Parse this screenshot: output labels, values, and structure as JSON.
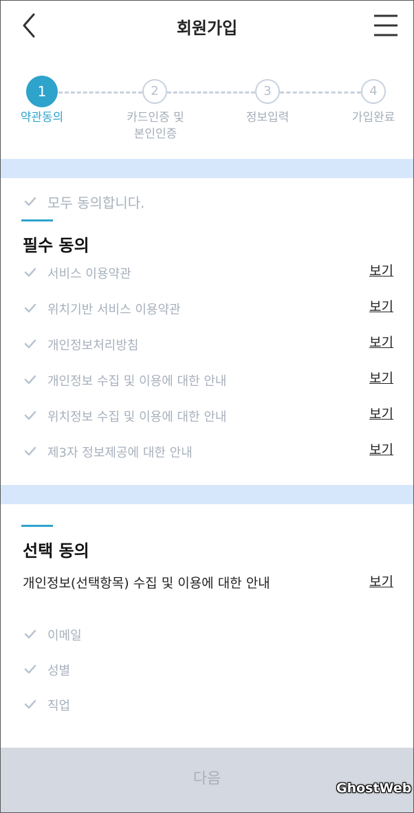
{
  "header": {
    "title": "회원가입",
    "back_icon": "chevron-left-icon",
    "menu_icon": "hamburger-menu-icon"
  },
  "steps": [
    {
      "number": "1",
      "label": "약관동의",
      "active": true
    },
    {
      "number": "2",
      "label": "카드인증 및\n본인인증",
      "active": false
    },
    {
      "number": "3",
      "label": "정보입력",
      "active": false
    },
    {
      "number": "4",
      "label": "가입완료",
      "active": false
    }
  ],
  "colors": {
    "accent": "#2ea3cc",
    "band": "#d6e7fb",
    "check": "#b9c3cf",
    "next_button_bg": "#d4d8e0"
  },
  "agree_all": {
    "label": "모두 동의합니다."
  },
  "required": {
    "title": "필수 동의",
    "items": [
      {
        "label": "서비스 이용약관",
        "link": "보기"
      },
      {
        "label": "위치기반 서비스 이용약관",
        "link": "보기"
      },
      {
        "label": "개인정보처리방침",
        "link": "보기"
      },
      {
        "label": "개인정보 수집 및 이용에 대한 안내",
        "link": "보기"
      },
      {
        "label": "위치정보 수집 및 이용에 대한 안내",
        "link": "보기"
      },
      {
        "label": "제3자 정보제공에 대한 안내",
        "link": "보기"
      }
    ]
  },
  "optional": {
    "title": "선택 동의",
    "notice": "개인정보(선택항목) 수집 및 이용에 대한 안내",
    "notice_link": "보기",
    "items": [
      {
        "label": "이메일"
      },
      {
        "label": "성별"
      },
      {
        "label": "직업"
      }
    ]
  },
  "next_button": {
    "label": "다음"
  },
  "watermark": "GhostWeb"
}
